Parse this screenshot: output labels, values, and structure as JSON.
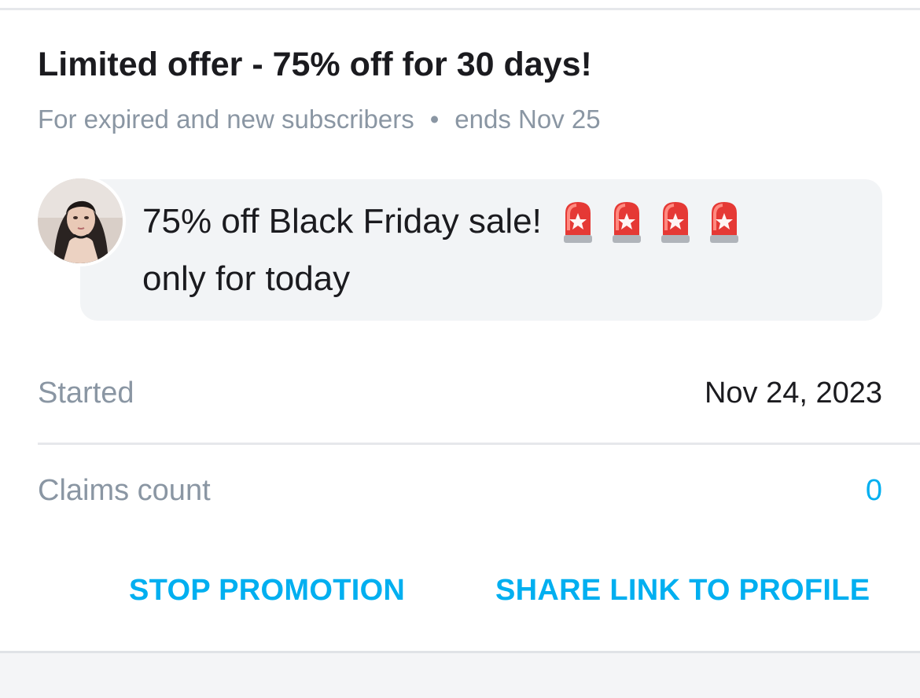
{
  "promotion": {
    "title": "Limited offer - 75% off for 30 days!",
    "audience": "For expired and new subscribers",
    "separator": "•",
    "ends": "ends Nov 25"
  },
  "message": {
    "line1": "75% off Black Friday sale!",
    "line2": "only for today",
    "emoji_icons": [
      "rotating-light-icon",
      "rotating-light-icon",
      "rotating-light-icon",
      "rotating-light-icon"
    ]
  },
  "details": {
    "started_label": "Started",
    "started_value": "Nov 24, 2023",
    "claims_label": "Claims count",
    "claims_value": "0"
  },
  "actions": {
    "stop_label": "STOP PROMOTION",
    "share_label": "SHARE LINK TO PROFILE"
  },
  "colors": {
    "accent": "#00aff0",
    "muted": "#8a96a3",
    "text": "#1b1b1f",
    "bubble": "#f2f4f6"
  }
}
